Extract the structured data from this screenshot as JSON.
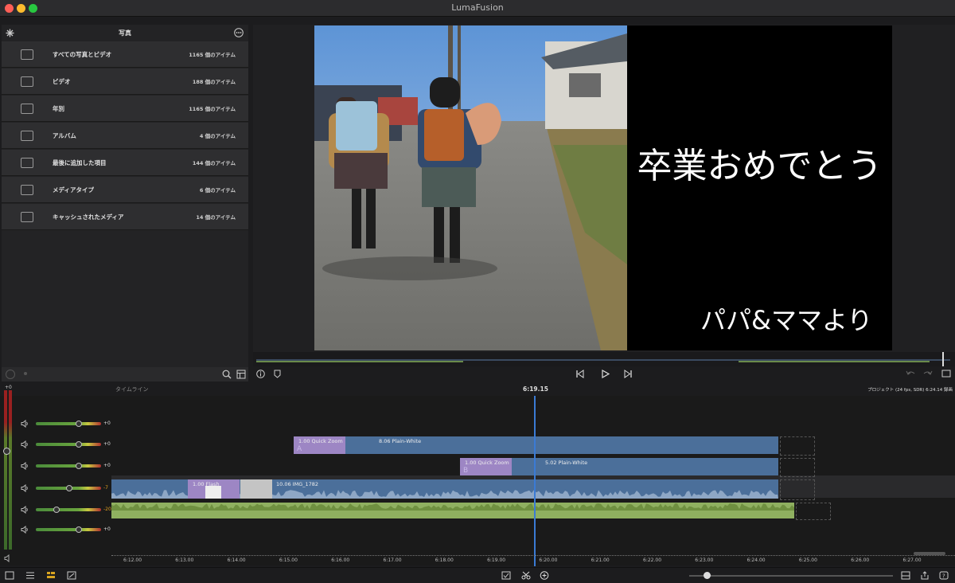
{
  "app": {
    "title": "LumaFusion"
  },
  "library": {
    "title": "写真",
    "items": [
      {
        "label": "すべての写真とビデオ",
        "count": "1165 個のアイテム",
        "icon": "folder-icon"
      },
      {
        "label": "ビデオ",
        "count": "188 個のアイテム",
        "icon": "video-icon"
      },
      {
        "label": "年別",
        "count": "1165 個のアイテム",
        "icon": "camera-icon"
      },
      {
        "label": "アルバム",
        "count": "4 個のアイテム",
        "icon": "album-icon"
      },
      {
        "label": "最後に追加した項目",
        "count": "144 個のアイテム",
        "icon": "folder-icon"
      },
      {
        "label": "メディアタイプ",
        "count": "6 個のアイテム",
        "icon": "folder-icon"
      },
      {
        "label": "キャッシュされたメディア",
        "count": "14 個のアイテム",
        "icon": "cache-icon"
      }
    ]
  },
  "preview": {
    "title_line1": "卒業おめでとう",
    "title_line2": "パパ&ママより"
  },
  "timeline": {
    "label": "タイムライン",
    "playhead_time": "6:19.15",
    "project_info": "プロジェクト (24 fps, SDR) 6:24.14 録画",
    "master_level": "+0",
    "track_levels": [
      "+0",
      "+0",
      "+0",
      "-7",
      "-20",
      "+0"
    ],
    "clips": {
      "track1_transition": "1.00  Quick Zoom",
      "track1_clip": "8.06  Plain-White",
      "track2_transition": "1.00  Quick Zoom",
      "track2_clip": "5.02  Plain-White",
      "main_transition": "1.00  Flash",
      "main_clip": "10.06  IMG_1782"
    },
    "ruler": [
      "6:12.00",
      "6:13.00",
      "6:14.00",
      "6:15.00",
      "6:16.00",
      "6:17.00",
      "6:18.00",
      "6:19.00",
      "6:20.00",
      "6:21.00",
      "6:22.00",
      "6:23.00",
      "6:24.00",
      "6:25.00",
      "6:26.00",
      "6:27.00"
    ]
  },
  "colors": {
    "accent": "#3a7bd5",
    "clip_blue": "#4b6f9a",
    "transition_purple": "#9d86c4",
    "audio_green": "#8fb060"
  }
}
